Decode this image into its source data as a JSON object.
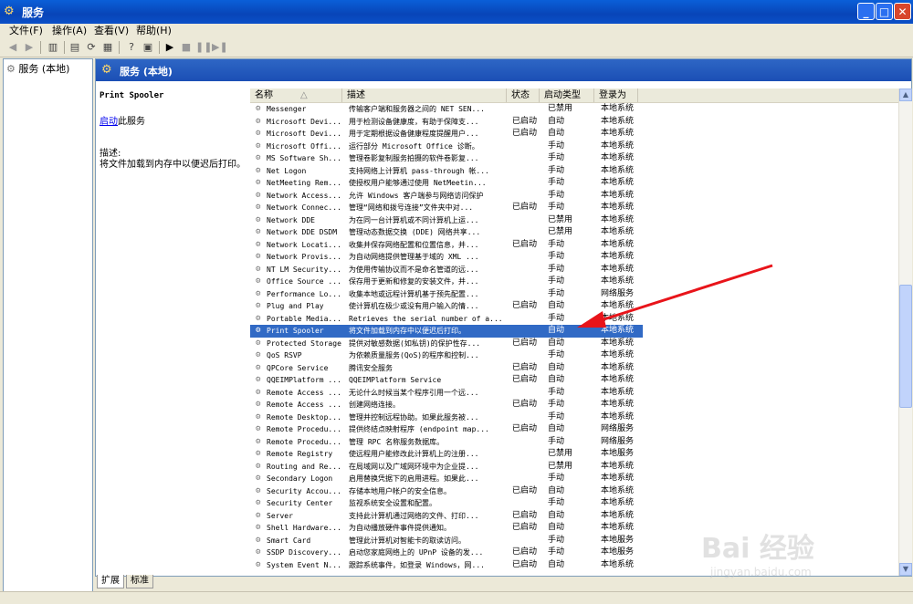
{
  "window": {
    "title": "服务",
    "min": "_",
    "max": "□",
    "close": "✕"
  },
  "menu": [
    "文件(F)",
    "操作(A)",
    "查看(V)",
    "帮助(H)"
  ],
  "tree": {
    "root": "服务 (本地)"
  },
  "header": {
    "title": "服务 (本地)"
  },
  "description": {
    "service_name": "Print Spooler",
    "start_link": "启动",
    "start_suffix": "此服务",
    "desc_label": "描述:",
    "desc_text": "将文件加载到内存中以便迟后打印。"
  },
  "columns": {
    "name": "名称",
    "desc": "描述",
    "status": "状态",
    "startup": "启动类型",
    "logon": "登录为"
  },
  "rows": [
    {
      "name": "Messenger",
      "desc": "传输客户端和服务器之间的 NET SEN...",
      "status": "",
      "startup": "已禁用",
      "logon": "本地系统"
    },
    {
      "name": "Microsoft Devi...",
      "desc": "用于检测设备健康度，有助于保障支...",
      "status": "已启动",
      "startup": "自动",
      "logon": "本地系统"
    },
    {
      "name": "Microsoft Devi...",
      "desc": "用于定期根据设备健康程度提醒用户...",
      "status": "已启动",
      "startup": "自动",
      "logon": "本地系统"
    },
    {
      "name": "Microsoft Offi...",
      "desc": "运行部分 Microsoft Office 诊断。",
      "status": "",
      "startup": "手动",
      "logon": "本地系统"
    },
    {
      "name": "MS Software Sh...",
      "desc": "管理卷影复制服务拍摄的软件卷影复...",
      "status": "",
      "startup": "手动",
      "logon": "本地系统"
    },
    {
      "name": "Net Logon",
      "desc": "支持网络上计算机 pass-through 帐...",
      "status": "",
      "startup": "手动",
      "logon": "本地系统"
    },
    {
      "name": "NetMeeting Rem...",
      "desc": "使授权用户能够通过使用 NetMeetin...",
      "status": "",
      "startup": "手动",
      "logon": "本地系统"
    },
    {
      "name": "Network Access...",
      "desc": "允许 Windows 客户端参与网络访问保护",
      "status": "",
      "startup": "手动",
      "logon": "本地系统"
    },
    {
      "name": "Network Connec...",
      "desc": "管理“网络和拨号连接”文件夹中对...",
      "status": "已启动",
      "startup": "手动",
      "logon": "本地系统"
    },
    {
      "name": "Network DDE",
      "desc": "为在同一台计算机或不同计算机上运...",
      "status": "",
      "startup": "已禁用",
      "logon": "本地系统"
    },
    {
      "name": "Network DDE DSDM",
      "desc": "管理动态数据交换 (DDE) 网络共享...",
      "status": "",
      "startup": "已禁用",
      "logon": "本地系统"
    },
    {
      "name": "Network Locati...",
      "desc": "收集并保存网络配置和位置信息，并...",
      "status": "已启动",
      "startup": "手动",
      "logon": "本地系统"
    },
    {
      "name": "Network Provis...",
      "desc": "为自动网络提供管理基于域的 XML ...",
      "status": "",
      "startup": "手动",
      "logon": "本地系统"
    },
    {
      "name": "NT LM Security...",
      "desc": "为使用传输协议而不是命名管道的远...",
      "status": "",
      "startup": "手动",
      "logon": "本地系统"
    },
    {
      "name": "Office Source ...",
      "desc": "保存用于更新和修复的安装文件，并...",
      "status": "",
      "startup": "手动",
      "logon": "本地系统"
    },
    {
      "name": "Performance Lo...",
      "desc": "收集本地或远程计算机基于预先配置...",
      "status": "",
      "startup": "手动",
      "logon": "网络服务"
    },
    {
      "name": "Plug and Play",
      "desc": "使计算机在极少或没有用户输入的情...",
      "status": "已启动",
      "startup": "自动",
      "logon": "本地系统"
    },
    {
      "name": "Portable Media...",
      "desc": "Retrieves the serial number of a...",
      "status": "",
      "startup": "手动",
      "logon": "本地系统"
    },
    {
      "name": "Print Spooler",
      "desc": "将文件加载到内存中以便迟后打印。",
      "status": "",
      "startup": "自动",
      "logon": "本地系统",
      "selected": true
    },
    {
      "name": "Protected Storage",
      "desc": "提供对敏感数据(如私钥)的保护性存...",
      "status": "已启动",
      "startup": "自动",
      "logon": "本地系统"
    },
    {
      "name": "QoS RSVP",
      "desc": "为依赖质量服务(QoS)的程序和控制...",
      "status": "",
      "startup": "手动",
      "logon": "本地系统"
    },
    {
      "name": "QPCore Service",
      "desc": "腾讯安全服务",
      "status": "已启动",
      "startup": "自动",
      "logon": "本地系统"
    },
    {
      "name": "QQEIMPlatform ...",
      "desc": "QQEIMPlatform Service",
      "status": "已启动",
      "startup": "自动",
      "logon": "本地系统"
    },
    {
      "name": "Remote Access ...",
      "desc": "无论什么时候当某个程序引用一个远...",
      "status": "",
      "startup": "手动",
      "logon": "本地系统"
    },
    {
      "name": "Remote Access ...",
      "desc": "创建网络连接。",
      "status": "已启动",
      "startup": "手动",
      "logon": "本地系统"
    },
    {
      "name": "Remote Desktop...",
      "desc": "管理并控制远程协助。如果此服务被...",
      "status": "",
      "startup": "手动",
      "logon": "本地系统"
    },
    {
      "name": "Remote Procedu...",
      "desc": "提供终结点映射程序 (endpoint map...",
      "status": "已启动",
      "startup": "自动",
      "logon": "网络服务"
    },
    {
      "name": "Remote Procedu...",
      "desc": "管理 RPC 名称服务数据库。",
      "status": "",
      "startup": "手动",
      "logon": "网络服务"
    },
    {
      "name": "Remote Registry",
      "desc": "使远程用户能修改此计算机上的注册...",
      "status": "",
      "startup": "已禁用",
      "logon": "本地服务"
    },
    {
      "name": "Routing and Re...",
      "desc": "在局域网以及广域网环境中为企业提...",
      "status": "",
      "startup": "已禁用",
      "logon": "本地系统"
    },
    {
      "name": "Secondary Logon",
      "desc": "启用替换凭据下的启用进程。如果此...",
      "status": "",
      "startup": "手动",
      "logon": "本地系统"
    },
    {
      "name": "Security Accou...",
      "desc": "存储本地用户帐户的安全信息。",
      "status": "已启动",
      "startup": "自动",
      "logon": "本地系统"
    },
    {
      "name": "Security Center",
      "desc": "监视系统安全设置和配置。",
      "status": "",
      "startup": "手动",
      "logon": "本地系统"
    },
    {
      "name": "Server",
      "desc": "支持此计算机通过网络的文件、打印...",
      "status": "已启动",
      "startup": "自动",
      "logon": "本地系统"
    },
    {
      "name": "Shell Hardware...",
      "desc": "为自动播放硬件事件提供通知。",
      "status": "已启动",
      "startup": "自动",
      "logon": "本地系统"
    },
    {
      "name": "Smart Card",
      "desc": "管理此计算机对智能卡的取读访问。",
      "status": "",
      "startup": "手动",
      "logon": "本地服务"
    },
    {
      "name": "SSDP Discovery...",
      "desc": "启动您家庭网络上的 UPnP 设备的发...",
      "status": "已启动",
      "startup": "手动",
      "logon": "本地服务"
    },
    {
      "name": "System Event N...",
      "desc": "跟踪系统事件，如登录 Windows，网...",
      "status": "已启动",
      "startup": "自动",
      "logon": "本地系统"
    }
  ],
  "tabs": [
    "扩展",
    "标准"
  ],
  "watermark": {
    "logo": "Bai 经验",
    "url": "jingyan.baidu.com"
  },
  "colors": {
    "selection": "#316ac5",
    "arrow": "#e8141a",
    "title_bar": "#0845b8"
  }
}
